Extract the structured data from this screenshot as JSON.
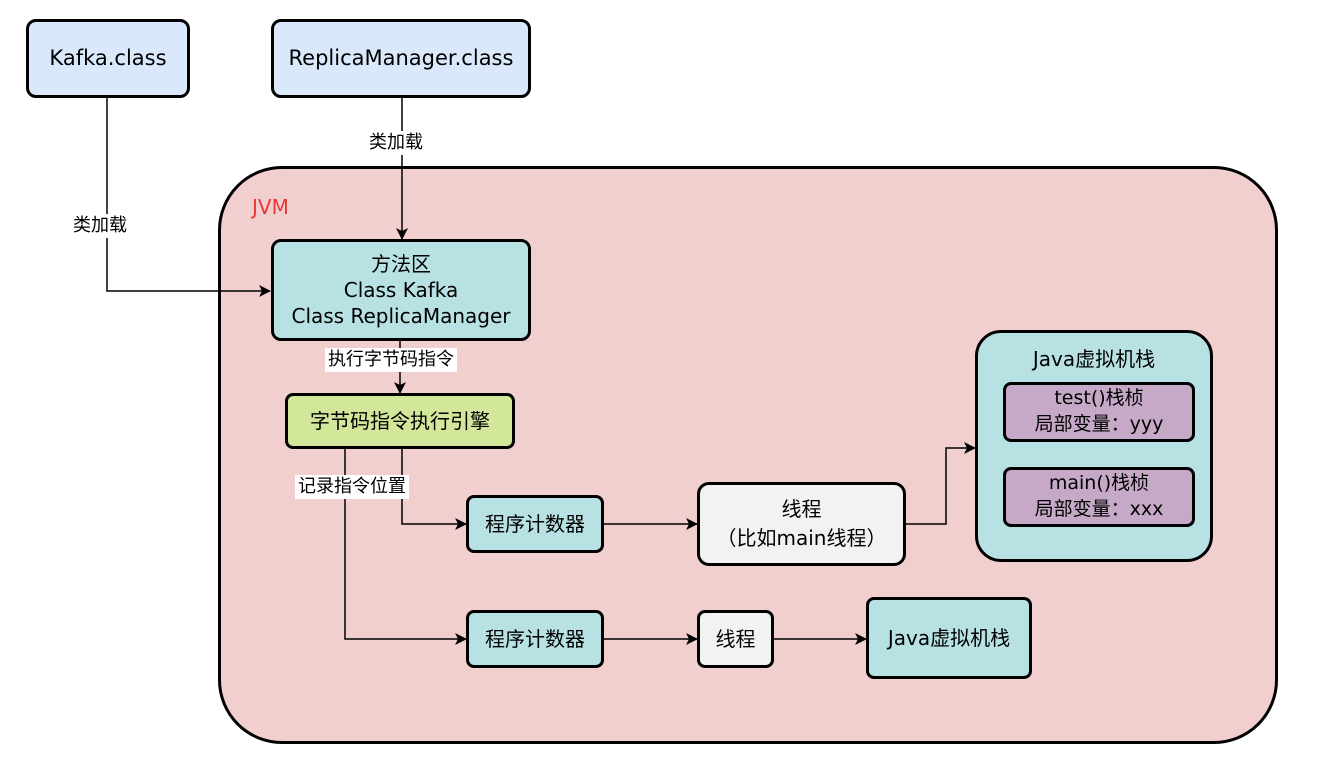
{
  "nodes": {
    "kafka_class": "Kafka.class",
    "replica_class": "ReplicaManager.class",
    "jvm_label": "JVM",
    "method_area": {
      "title": "方法区",
      "line1": "Class Kafka",
      "line2": "Class ReplicaManager"
    },
    "engine": "字节码指令执行引擎",
    "pc_top": "程序计数器",
    "thread_top": {
      "line1": "线程",
      "line2": "（比如main线程）"
    },
    "jvm_stack_top": {
      "title": "Java虚拟机栈",
      "frame1": {
        "line1": "test()栈桢",
        "line2": "局部变量：yyy"
      },
      "frame2": {
        "line1": "main()栈桢",
        "line2": "局部变量：xxx"
      }
    },
    "pc_bottom": "程序计数器",
    "thread_bottom": "线程",
    "jvm_stack_bottom": "Java虚拟机栈"
  },
  "edges": {
    "load_kafka": "类加载",
    "load_replica": "类加载",
    "exec_bytecode": "执行字节码指令",
    "record_position": "记录指令位置"
  },
  "colors": {
    "class_file": "#dae8fc",
    "jvm_area": "#f2cfcf",
    "jvm_label": "#e53935",
    "teal_node": "#b7e1e3",
    "engine": "#d3e79a",
    "thread": "#f2f2f2",
    "stack_frame": "#c6a9c6"
  }
}
